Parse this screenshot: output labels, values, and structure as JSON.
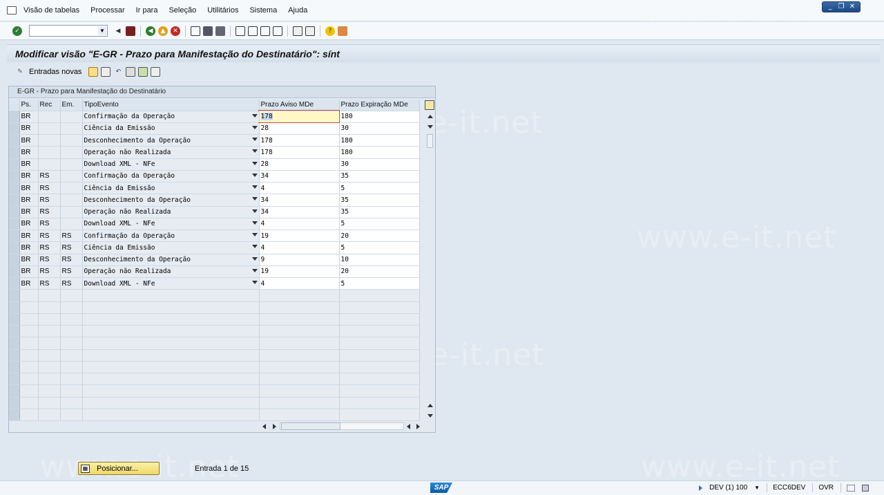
{
  "menu": {
    "items": [
      "Visão de tabelas",
      "Processar",
      "Ir para",
      "Seleção",
      "Utilitários",
      "Sistema",
      "Ajuda"
    ]
  },
  "title": "Modificar visão \"E-GR - Prazo para Manifestação do Destinatário\": sínt",
  "app_toolbar": {
    "new_entries": "Entradas novas"
  },
  "table": {
    "caption": "E-GR - Prazo para Manifestação do Destinatário",
    "headers": {
      "ps": "Ps.",
      "rec": "Rec",
      "em": "Em.",
      "tipo": "TipoEvento",
      "aviso": "Prazo Aviso MDe",
      "expiracao": "Prazo Expiração MDe"
    },
    "rows": [
      {
        "ps": "BR",
        "rec": "",
        "em": "",
        "tipo": "Confirmação da Operação",
        "aviso": "178",
        "exp": "180"
      },
      {
        "ps": "BR",
        "rec": "",
        "em": "",
        "tipo": "Ciência da Emissão",
        "aviso": "28",
        "exp": "30"
      },
      {
        "ps": "BR",
        "rec": "",
        "em": "",
        "tipo": "Desconhecimento da Operação",
        "aviso": "178",
        "exp": "180"
      },
      {
        "ps": "BR",
        "rec": "",
        "em": "",
        "tipo": "Operação não Realizada",
        "aviso": "178",
        "exp": "180"
      },
      {
        "ps": "BR",
        "rec": "",
        "em": "",
        "tipo": "Download XML - NFe",
        "aviso": "28",
        "exp": "30"
      },
      {
        "ps": "BR",
        "rec": "RS",
        "em": "",
        "tipo": "Confirmação da Operação",
        "aviso": "34",
        "exp": "35"
      },
      {
        "ps": "BR",
        "rec": "RS",
        "em": "",
        "tipo": "Ciência da Emissão",
        "aviso": "4",
        "exp": "5"
      },
      {
        "ps": "BR",
        "rec": "RS",
        "em": "",
        "tipo": "Desconhecimento da Operação",
        "aviso": "34",
        "exp": "35"
      },
      {
        "ps": "BR",
        "rec": "RS",
        "em": "",
        "tipo": "Operação não Realizada",
        "aviso": "34",
        "exp": "35"
      },
      {
        "ps": "BR",
        "rec": "RS",
        "em": "",
        "tipo": "Download XML - NFe",
        "aviso": "4",
        "exp": "5"
      },
      {
        "ps": "BR",
        "rec": "RS",
        "em": "RS",
        "tipo": "Confirmação da Operação",
        "aviso": "19",
        "exp": "20"
      },
      {
        "ps": "BR",
        "rec": "RS",
        "em": "RS",
        "tipo": "Ciência da Emissão",
        "aviso": "4",
        "exp": "5"
      },
      {
        "ps": "BR",
        "rec": "RS",
        "em": "RS",
        "tipo": "Desconhecimento da Operação",
        "aviso": "9",
        "exp": "10"
      },
      {
        "ps": "BR",
        "rec": "RS",
        "em": "RS",
        "tipo": "Operação não Realizada",
        "aviso": "19",
        "exp": "20"
      },
      {
        "ps": "BR",
        "rec": "RS",
        "em": "RS",
        "tipo": "Download XML - NFe",
        "aviso": "4",
        "exp": "5"
      }
    ],
    "empty_rows": 11
  },
  "footer": {
    "position_button": "Posicionar...",
    "entry_info": "Entrada 1 de 15"
  },
  "status": {
    "system": "DEV (1) 100",
    "server": "ECC6DEV",
    "mode": "OVR",
    "logo": "SAP"
  },
  "watermark": "www.e-it.net",
  "colors": {
    "background": "#dfe8f1",
    "focus_cell": "#fff8c6",
    "button": "#f0d866"
  },
  "icons": [
    "enter-icon",
    "save-icon",
    "back-icon",
    "exit-icon",
    "cancel-icon",
    "print-icon",
    "find-icon",
    "find-next-icon",
    "first-page-icon",
    "prev-page-icon",
    "next-page-icon",
    "last-page-icon",
    "new-session-icon",
    "shortcut-icon",
    "help-icon",
    "layout-icon"
  ]
}
